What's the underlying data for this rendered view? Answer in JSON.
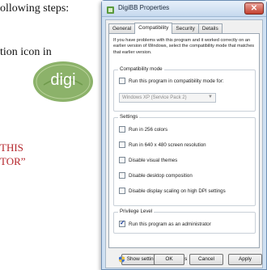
{
  "document": {
    "line1": "ollowing steps:",
    "line2": "tion icon in",
    "red_line1": "THIS",
    "red_line2": "TOR”",
    "logo_text": "digi"
  },
  "window": {
    "title": "DigiBB Properties",
    "close_label": "✕"
  },
  "tabs": [
    {
      "label": "General"
    },
    {
      "label": "Compatibility",
      "active": true
    },
    {
      "label": "Security"
    },
    {
      "label": "Details"
    }
  ],
  "description": "If you have problems with this program and it worked correctly on an earlier version of Windows, select the compatibility mode that matches that earlier version.",
  "compat_mode": {
    "group_label": "Compatibility mode",
    "checkbox_label": "Run this program in compatibility mode for:",
    "checked": false,
    "select_value": "Windows XP (Service Pack 2)"
  },
  "settings": {
    "group_label": "Settings",
    "items": [
      {
        "label": "Run in 256 colors",
        "checked": false
      },
      {
        "label": "Run in 640 x 480 screen resolution",
        "checked": false
      },
      {
        "label": "Disable visual themes",
        "checked": false
      },
      {
        "label": "Disable desktop composition",
        "checked": false
      },
      {
        "label": "Disable display scaling on high DPI settings",
        "checked": false
      }
    ]
  },
  "privilege": {
    "group_label": "Privilege Level",
    "checkbox_label": "Run this program as an administrator",
    "checked": true
  },
  "buttons": {
    "all_users": "Show settings for all users",
    "ok": "OK",
    "cancel": "Cancel",
    "apply": "Apply"
  },
  "colors": {
    "window_frame": "#cfe0f2",
    "close_button": "#c2402f",
    "doc_red_text": "#b5262c",
    "logo_green": "#8cb26a"
  }
}
